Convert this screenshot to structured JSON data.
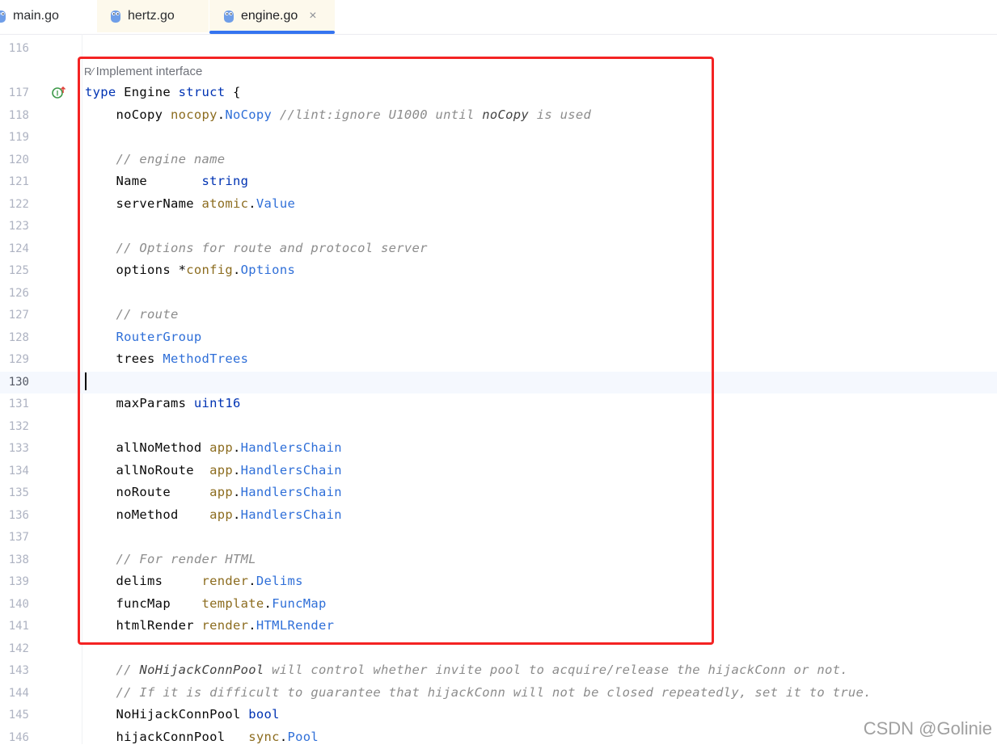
{
  "tabs": [
    {
      "label": "main.go",
      "icon": "go-gopher-icon"
    },
    {
      "label": "hertz.go",
      "icon": "go-gopher-icon"
    },
    {
      "label": "engine.go",
      "icon": "go-gopher-icon",
      "active": true,
      "close": "×"
    }
  ],
  "hint": {
    "icon": "implement-icon",
    "text": "Implement interface"
  },
  "colors": {
    "accent": "#3574f0",
    "highlight_box": "#f42323"
  },
  "current_line": "130",
  "lines": [
    {
      "n": "116",
      "segs": []
    },
    {
      "n": "117",
      "segs": [
        [
          "kw",
          "type"
        ],
        [
          "",
          "",
          " Engine "
        ],
        [
          "kw",
          "struct"
        ],
        [
          "",
          " {"
        ]
      ]
    },
    {
      "n": "118",
      "segs": [
        [
          "",
          "    noCopy "
        ],
        [
          "pkg",
          "nocopy"
        ],
        [
          "",
          "."
        ],
        [
          "type",
          "NoCopy"
        ],
        [
          "",
          " "
        ],
        [
          "cmt",
          "//lint:ignore U1000 until "
        ],
        [
          "cmt-b",
          "noCopy"
        ],
        [
          "cmt",
          " is used"
        ]
      ]
    },
    {
      "n": "119",
      "segs": []
    },
    {
      "n": "120",
      "segs": [
        [
          "cmt",
          "    // engine name"
        ]
      ]
    },
    {
      "n": "121",
      "segs": [
        [
          "",
          "    Name       "
        ],
        [
          "builtin",
          "string"
        ]
      ]
    },
    {
      "n": "122",
      "segs": [
        [
          "",
          "    serverName "
        ],
        [
          "pkg",
          "atomic"
        ],
        [
          "",
          "."
        ],
        [
          "type",
          "Value"
        ]
      ]
    },
    {
      "n": "123",
      "segs": []
    },
    {
      "n": "124",
      "segs": [
        [
          "cmt",
          "    // Options for route and protocol server"
        ]
      ]
    },
    {
      "n": "125",
      "segs": [
        [
          "",
          "    options *"
        ],
        [
          "pkg",
          "config"
        ],
        [
          "",
          "."
        ],
        [
          "type",
          "Options"
        ]
      ]
    },
    {
      "n": "126",
      "segs": []
    },
    {
      "n": "127",
      "segs": [
        [
          "cmt",
          "    // route"
        ]
      ]
    },
    {
      "n": "128",
      "segs": [
        [
          "",
          "    "
        ],
        [
          "type",
          "RouterGroup"
        ]
      ]
    },
    {
      "n": "129",
      "segs": [
        [
          "",
          "    trees "
        ],
        [
          "type",
          "MethodTrees"
        ]
      ]
    },
    {
      "n": "130",
      "segs": []
    },
    {
      "n": "131",
      "segs": [
        [
          "",
          "    maxParams "
        ],
        [
          "builtin",
          "uint16"
        ]
      ]
    },
    {
      "n": "132",
      "segs": []
    },
    {
      "n": "133",
      "segs": [
        [
          "",
          "    allNoMethod "
        ],
        [
          "pkg",
          "app"
        ],
        [
          "",
          "."
        ],
        [
          "type",
          "HandlersChain"
        ]
      ]
    },
    {
      "n": "134",
      "segs": [
        [
          "",
          "    allNoRoute  "
        ],
        [
          "pkg",
          "app"
        ],
        [
          "",
          "."
        ],
        [
          "type",
          "HandlersChain"
        ]
      ]
    },
    {
      "n": "135",
      "segs": [
        [
          "",
          "    noRoute     "
        ],
        [
          "pkg",
          "app"
        ],
        [
          "",
          "."
        ],
        [
          "type",
          "HandlersChain"
        ]
      ]
    },
    {
      "n": "136",
      "segs": [
        [
          "",
          "    noMethod    "
        ],
        [
          "pkg",
          "app"
        ],
        [
          "",
          "."
        ],
        [
          "type",
          "HandlersChain"
        ]
      ]
    },
    {
      "n": "137",
      "segs": []
    },
    {
      "n": "138",
      "segs": [
        [
          "cmt",
          "    // For render HTML"
        ]
      ]
    },
    {
      "n": "139",
      "segs": [
        [
          "",
          "    delims     "
        ],
        [
          "pkg",
          "render"
        ],
        [
          "",
          "."
        ],
        [
          "type",
          "Delims"
        ]
      ]
    },
    {
      "n": "140",
      "segs": [
        [
          "",
          "    funcMap    "
        ],
        [
          "pkg",
          "template"
        ],
        [
          "",
          "."
        ],
        [
          "type",
          "FuncMap"
        ]
      ]
    },
    {
      "n": "141",
      "segs": [
        [
          "",
          "    htmlRender "
        ],
        [
          "pkg",
          "render"
        ],
        [
          "",
          "."
        ],
        [
          "type",
          "HTMLRender"
        ]
      ]
    },
    {
      "n": "142",
      "segs": []
    },
    {
      "n": "143",
      "segs": [
        [
          "cmt",
          "    // "
        ],
        [
          "cmt-b",
          "NoHijackConnPool"
        ],
        [
          "cmt",
          " will control whether invite pool to acquire/release the hijackConn or not."
        ]
      ]
    },
    {
      "n": "144",
      "segs": [
        [
          "cmt",
          "    // If it is difficult to guarantee that hijackConn will not be closed repeatedly, set it to true."
        ]
      ]
    },
    {
      "n": "145",
      "segs": [
        [
          "",
          "    NoHijackConnPool "
        ],
        [
          "builtin",
          "bool"
        ]
      ]
    },
    {
      "n": "146",
      "segs": [
        [
          "",
          "    hijackConnPool   "
        ],
        [
          "pkg",
          "sync"
        ],
        [
          "",
          "."
        ],
        [
          "type",
          "Pool"
        ]
      ]
    }
  ],
  "watermark": "CSDN @Golinie"
}
